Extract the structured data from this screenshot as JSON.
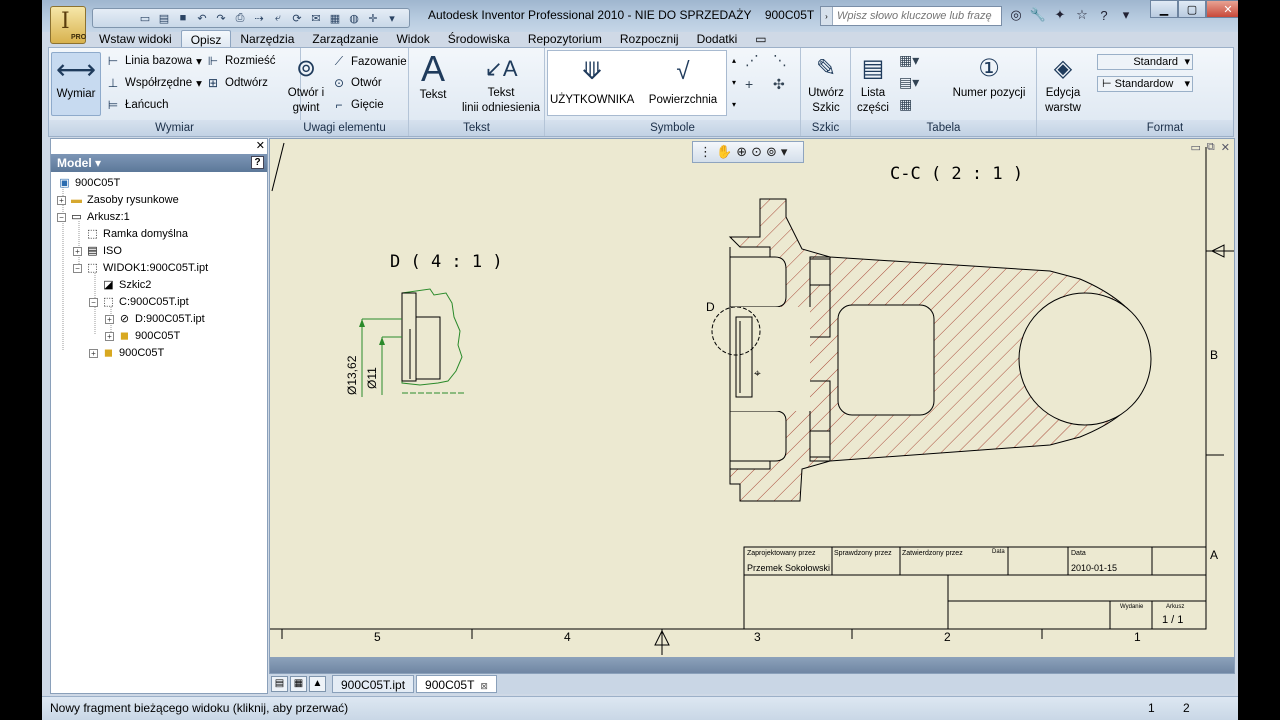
{
  "window": {
    "title": "Autodesk Inventor Professional 2010 - NIE DO SPRZEDAŻY",
    "doc_name": "900C05T",
    "search_placeholder": "Wpisz słowo kluczowe lub frazę",
    "app_badge": "PRO"
  },
  "tabs": [
    "Wstaw widoki",
    "Opisz",
    "Narzędzia",
    "Zarządzanie",
    "Widok",
    "Środowiska",
    "Repozytorium",
    "Rozpocznij",
    "Dodatki"
  ],
  "active_tab": "Opisz",
  "ribbon": {
    "wymiar": {
      "label": "Wymiar",
      "main_button": "Wymiar",
      "linia_bazowa": "Linia bazowa",
      "wspolrzedne": "Współrzędne",
      "lancuch": "Łańcuch",
      "rozmiesc": "Rozmieść",
      "odtworz": "Odtwórz"
    },
    "uwagi": {
      "label": "Uwagi elementu",
      "otwor_gwint_1": "Otwór i",
      "otwor_gwint_2": "gwint",
      "fazowanie": "Fazowanie",
      "otwor": "Otwór",
      "giecie": "Gięcie"
    },
    "tekst": {
      "label": "Tekst",
      "tekst": "Tekst",
      "tekst_linii_1": "Tekst",
      "tekst_linii_2": "linii odniesienia"
    },
    "symbole": {
      "label": "Symbole",
      "uzytkownika": "UŻYTKOWNIKA",
      "powierzchnia": "Powierzchnia"
    },
    "szkic": {
      "label": "Szkic",
      "utworz_1": "Utwórz",
      "utworz_2": "Szkic"
    },
    "tabela": {
      "label": "Tabela",
      "lista_1": "Lista",
      "lista_2": "części",
      "numer_pozycji": "Numer pozycji"
    },
    "warstwy": {
      "edycja_1": "Edycja",
      "edycja_2": "warstw"
    },
    "format": {
      "label": "Format",
      "style1": "Standard",
      "style2": "Standardow"
    }
  },
  "browser": {
    "title": "Model",
    "items": [
      {
        "label": "900C05T",
        "icon": "drawing-icon"
      },
      {
        "label": "Zasoby rysunkowe",
        "icon": "folder-icon"
      },
      {
        "label": "Arkusz:1",
        "icon": "sheet-icon"
      },
      {
        "label": "Ramka domyślna",
        "icon": "border-icon"
      },
      {
        "label": "ISO",
        "icon": "titleblock-icon"
      },
      {
        "label": "WIDOK1:900C05T.ipt",
        "icon": "view-icon"
      },
      {
        "label": "Szkic2",
        "icon": "sketch-icon"
      },
      {
        "label": "C:900C05T.ipt",
        "icon": "section-view-icon"
      },
      {
        "label": "D:900C05T.ipt",
        "icon": "detail-view-icon"
      },
      {
        "label": "900C05T",
        "icon": "part-icon"
      },
      {
        "label": "900C05T",
        "icon": "part-icon"
      }
    ]
  },
  "drawing": {
    "section_label": "C-C ( 2 : 1 )",
    "detail_label": "D ( 4 : 1 )",
    "detail_marker": "D",
    "dim_outer": "Ø13,62",
    "dim_inner": "Ø11",
    "zone_b": "B",
    "zone_a": "A",
    "ruler": [
      "5",
      "4",
      "3",
      "2",
      "1"
    ],
    "title_block": {
      "designed_by_label": "Zaprojektowany przez",
      "checked_by_label": "Sprawdzony przez",
      "approved_by_label": "Zatwierdzony przez",
      "date_label_1": "Data",
      "date_label_2": "Data",
      "designer": "Przemek Sokołowski",
      "date": "2010-01-15",
      "edition_label": "Wydanie",
      "sheet_label": "Arkusz",
      "sheet": "1 / 1"
    }
  },
  "doc_tabs": [
    "900C05T.ipt",
    "900C05T"
  ],
  "status": {
    "text": "Nowy fragment bieżącego widoku (kliknij, aby przerwać)",
    "n1": "1",
    "n2": "2"
  }
}
